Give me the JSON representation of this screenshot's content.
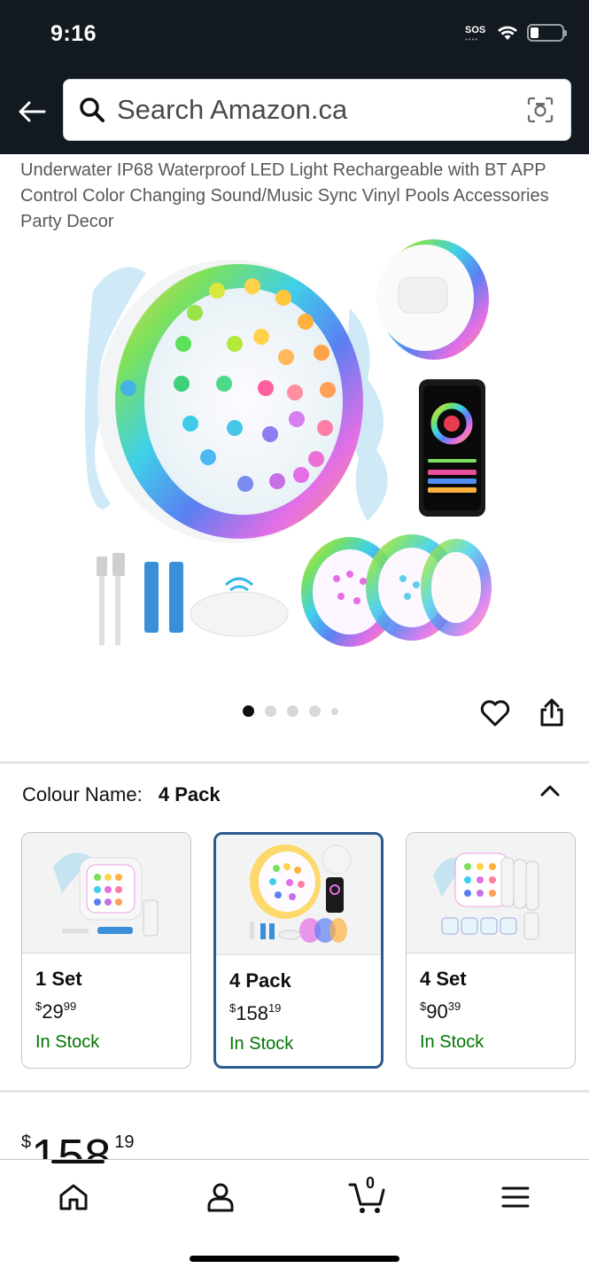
{
  "status_bar": {
    "time": "9:16",
    "sos": "SOS"
  },
  "header": {
    "search_placeholder": "Search Amazon.ca"
  },
  "product": {
    "title": "Underwater IP68 Waterproof LED Light Rechargeable with BT APP Control Color Changing Sound/Music Sync Vinyl Pools Accessories Party Decor",
    "image_count": 5,
    "active_image": 1
  },
  "colour": {
    "label": "Colour Name:",
    "value": "4 Pack"
  },
  "variants": [
    {
      "name": "1 Set",
      "currency": "$",
      "whole": "29",
      "cents": "99",
      "stock": "In Stock",
      "selected": false
    },
    {
      "name": "4 Pack",
      "currency": "$",
      "whole": "158",
      "cents": "19",
      "stock": "In Stock",
      "selected": true
    },
    {
      "name": "4 Set",
      "currency": "$",
      "whole": "90",
      "cents": "39",
      "stock": "In Stock",
      "selected": false
    }
  ],
  "price": {
    "currency": "$",
    "whole": "158",
    "cents": "19"
  },
  "nav": {
    "cart_count": "0",
    "items": [
      "home-icon",
      "account-icon",
      "cart-icon",
      "menu-icon"
    ]
  },
  "colors": {
    "header_bg": "#131921",
    "in_stock": "#007600",
    "selected_border": "#2a5b8c"
  }
}
